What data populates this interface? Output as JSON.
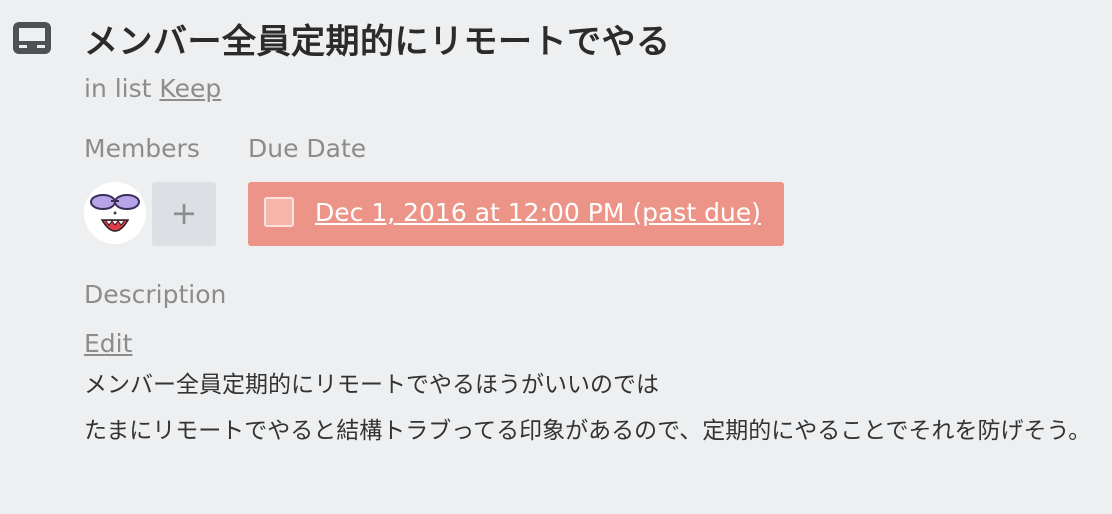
{
  "card": {
    "title": "メンバー全員定期的にリモートでやる",
    "in_list_prefix": "in list",
    "list_name": "Keep"
  },
  "members": {
    "label": "Members",
    "add_symbol": "+"
  },
  "due": {
    "label": "Due Date",
    "text": "Dec 1, 2016 at 12:00 PM (past due)",
    "badge_color": "#ec9488"
  },
  "description": {
    "label": "Description",
    "edit_label": "Edit",
    "paragraphs": [
      "メンバー全員定期的にリモートでやるほうがいいのでは",
      "たまにリモートでやると結構トラブってる印象があるので、定期的にやることでそれを防げそう。"
    ]
  },
  "icons": {
    "card": "card-icon",
    "avatar": "avatar"
  }
}
